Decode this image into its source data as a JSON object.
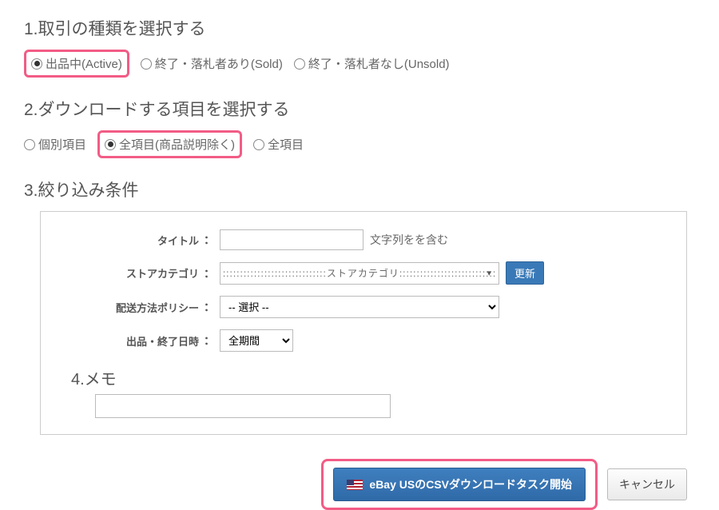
{
  "section1": {
    "title": "1.取引の種類を選択する",
    "options": [
      {
        "label": "出品中(Active)",
        "selected": true,
        "highlighted": true
      },
      {
        "label": "終了・落札者あり(Sold)",
        "selected": false,
        "highlighted": false
      },
      {
        "label": "終了・落札者なし(Unsold)",
        "selected": false,
        "highlighted": false
      }
    ]
  },
  "section2": {
    "title": "2.ダウンロードする項目を選択する",
    "options": [
      {
        "label": "個別項目",
        "selected": false,
        "highlighted": false
      },
      {
        "label": "全項目(商品説明除く)",
        "selected": true,
        "highlighted": true
      },
      {
        "label": "全項目",
        "selected": false,
        "highlighted": false
      }
    ]
  },
  "section3": {
    "title": "3.絞り込み条件",
    "form": {
      "title_label": "タイトル",
      "title_value": "",
      "title_suffix": "文字列をを含む",
      "store_cat_label": "ストアカテゴリ",
      "store_cat_value": "::::::::::::::::::::::::::::::ストアカテゴリ::::::::::::::::::::::::::::",
      "update_btn": "更新",
      "shipping_label": "配送方法ポリシー",
      "shipping_value": "-- 選択 --",
      "date_label": "出品・終了日時",
      "date_value": "全期間"
    }
  },
  "section4": {
    "title": "4.メモ",
    "value": ""
  },
  "footer": {
    "primary_btn": "eBay USのCSVダウンロードタスク開始",
    "cancel_btn": "キャンセル"
  }
}
